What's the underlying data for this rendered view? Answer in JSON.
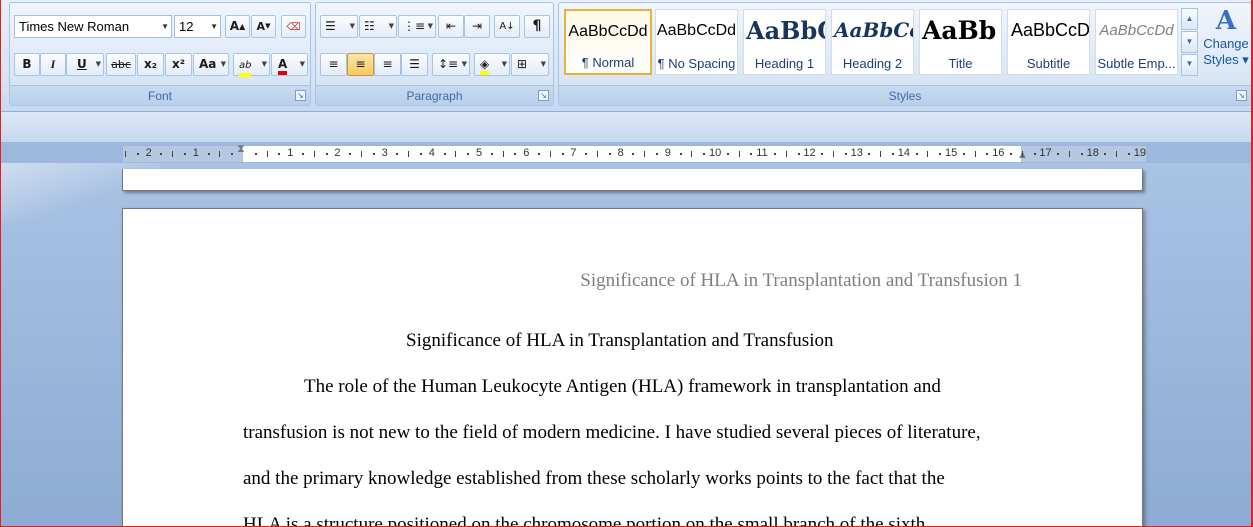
{
  "font_group": {
    "font_name": "Times New Roman",
    "font_size": "12",
    "grow_font": "A",
    "shrink_font": "A",
    "clear_format": "A",
    "bold": "B",
    "italic": "I",
    "underline": "U",
    "strikethrough": "abc",
    "subscript": "x₂",
    "superscript": "x²",
    "change_case": "Aa",
    "highlight": "ab",
    "font_color": "A",
    "label": "Font"
  },
  "paragraph_group": {
    "label": "Paragraph",
    "sort": "A↓",
    "show_marks": "¶"
  },
  "styles_group": {
    "label": "Styles",
    "items": [
      {
        "sample": "AaBbCcDd",
        "name": "¶ Normal"
      },
      {
        "sample": "AaBbCcDd",
        "name": "¶ No Spacing"
      },
      {
        "sample": "AaBbC",
        "name": "Heading 1"
      },
      {
        "sample": "AaBbCc",
        "name": "Heading 2"
      },
      {
        "sample": "AaBb",
        "name": "Title"
      },
      {
        "sample": "AaBbCcD",
        "name": "Subtitle"
      },
      {
        "sample": "AaBbCcDd",
        "name": "Subtle Emp..."
      }
    ],
    "change_styles_line1": "Change",
    "change_styles_line2": "Styles ▾"
  },
  "ruler": {
    "labels": [
      "2",
      "1",
      "1",
      "2",
      "3",
      "4",
      "5",
      "6",
      "7",
      "8",
      "9",
      "10",
      "11",
      "12",
      "13",
      "14",
      "15",
      "16",
      "17",
      "18",
      "19"
    ]
  },
  "document": {
    "header": "Significance of HLA in Transplantation and Transfusion 1",
    "title": "Significance of HLA in Transplantation and Transfusion",
    "lines": [
      "The role of the Human Leukocyte Antigen (HLA) framework in transplantation and",
      "transfusion is not new to the field of modern medicine. I have studied several pieces of literature,",
      "and the primary knowledge established from these scholarly works points to the fact that the",
      "HLA is a structure positioned on the chromosome portion on the small branch of the sixth"
    ]
  },
  "colors": {
    "ribbon_text": "#15428b",
    "selected_style_border": "#e9b33b",
    "highlight_yellow": "#ffff00",
    "font_color_red": "#e60000",
    "header_gray": "#7f7f7f"
  }
}
